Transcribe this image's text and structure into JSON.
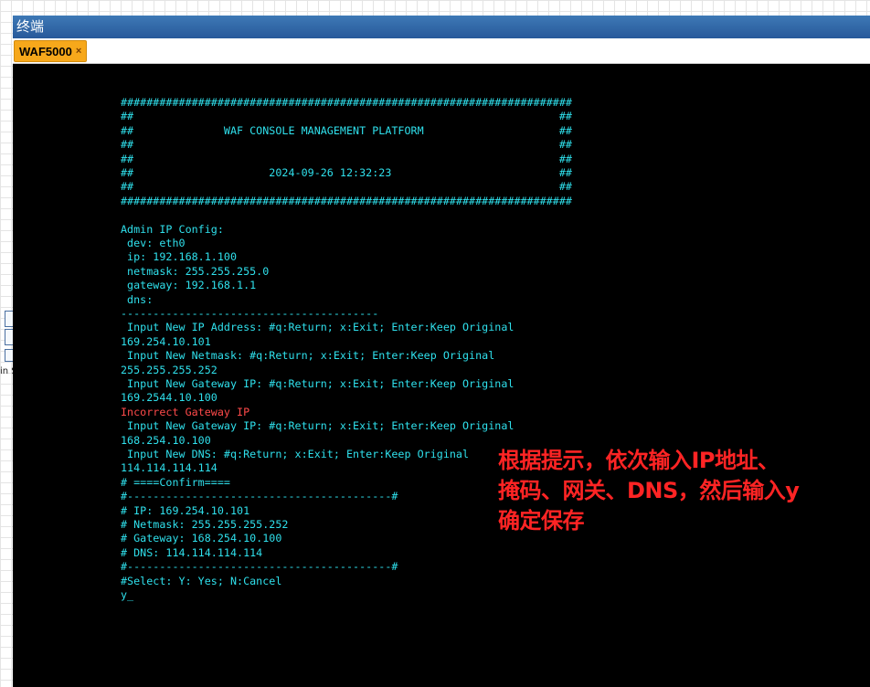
{
  "window": {
    "title": "终端"
  },
  "tabs": [
    {
      "label": "WAF5000",
      "close_icon": "×"
    }
  ],
  "side_stub": {
    "label": "in S"
  },
  "terminal": {
    "lines": [
      {
        "text": "######################################################################",
        "color": "cyan"
      },
      {
        "text": "##                                                                  ##",
        "color": "cyan"
      },
      {
        "text": "##              WAF CONSOLE MANAGEMENT PLATFORM                     ##",
        "color": "cyan"
      },
      {
        "text": "##                                                                  ##",
        "color": "cyan"
      },
      {
        "text": "##                                                                  ##",
        "color": "cyan"
      },
      {
        "text": "##                     2024-09-26 12:32:23                          ##",
        "color": "cyan"
      },
      {
        "text": "##                                                                  ##",
        "color": "cyan"
      },
      {
        "text": "######################################################################",
        "color": "cyan"
      },
      {
        "text": "",
        "color": "cyan"
      },
      {
        "text": "Admin IP Config:",
        "color": "cyan"
      },
      {
        "text": " dev: eth0",
        "color": "cyan"
      },
      {
        "text": " ip: 192.168.1.100",
        "color": "cyan"
      },
      {
        "text": " netmask: 255.255.255.0",
        "color": "cyan"
      },
      {
        "text": " gateway: 192.168.1.1",
        "color": "cyan"
      },
      {
        "text": " dns:",
        "color": "cyan"
      },
      {
        "text": "----------------------------------------",
        "color": "cyan"
      },
      {
        "text": " Input New IP Address: #q:Return; x:Exit; Enter:Keep Original",
        "color": "cyan"
      },
      {
        "text": "169.254.10.101",
        "color": "cyan"
      },
      {
        "text": " Input New Netmask: #q:Return; x:Exit; Enter:Keep Original",
        "color": "cyan"
      },
      {
        "text": "255.255.255.252",
        "color": "cyan"
      },
      {
        "text": " Input New Gateway IP: #q:Return; x:Exit; Enter:Keep Original",
        "color": "cyan"
      },
      {
        "text": "169.2544.10.100",
        "color": "cyan"
      },
      {
        "text": "Incorrect Gateway IP",
        "color": "red"
      },
      {
        "text": " Input New Gateway IP: #q:Return; x:Exit; Enter:Keep Original",
        "color": "cyan"
      },
      {
        "text": "168.254.10.100",
        "color": "cyan"
      },
      {
        "text": " Input New DNS: #q:Return; x:Exit; Enter:Keep Original",
        "color": "cyan"
      },
      {
        "text": "114.114.114.114",
        "color": "cyan"
      },
      {
        "text": "# ====Confirm====",
        "color": "cyan"
      },
      {
        "text": "#-----------------------------------------#",
        "color": "cyan"
      },
      {
        "text": "# IP: 169.254.10.101",
        "color": "cyan"
      },
      {
        "text": "# Netmask: 255.255.255.252",
        "color": "cyan"
      },
      {
        "text": "# Gateway: 168.254.10.100",
        "color": "cyan"
      },
      {
        "text": "# DNS: 114.114.114.114",
        "color": "cyan"
      },
      {
        "text": "#-----------------------------------------#",
        "color": "cyan"
      },
      {
        "text": "#Select: Y: Yes; N:Cancel",
        "color": "cyan"
      },
      {
        "text": "y_",
        "color": "cyan"
      }
    ]
  },
  "annotation": {
    "lines": [
      "根据提示，依次输入IP地址、",
      "掩码、网关、DNS，然后输入y",
      "确定保存"
    ],
    "color": "#ff2424"
  },
  "colors": {
    "terminal_bg": "#000000",
    "terminal_text": "#2fe0ec",
    "error_text": "#ff4a4a",
    "titlebar": "#2f67a8",
    "tab_active": "#f7a81b"
  }
}
